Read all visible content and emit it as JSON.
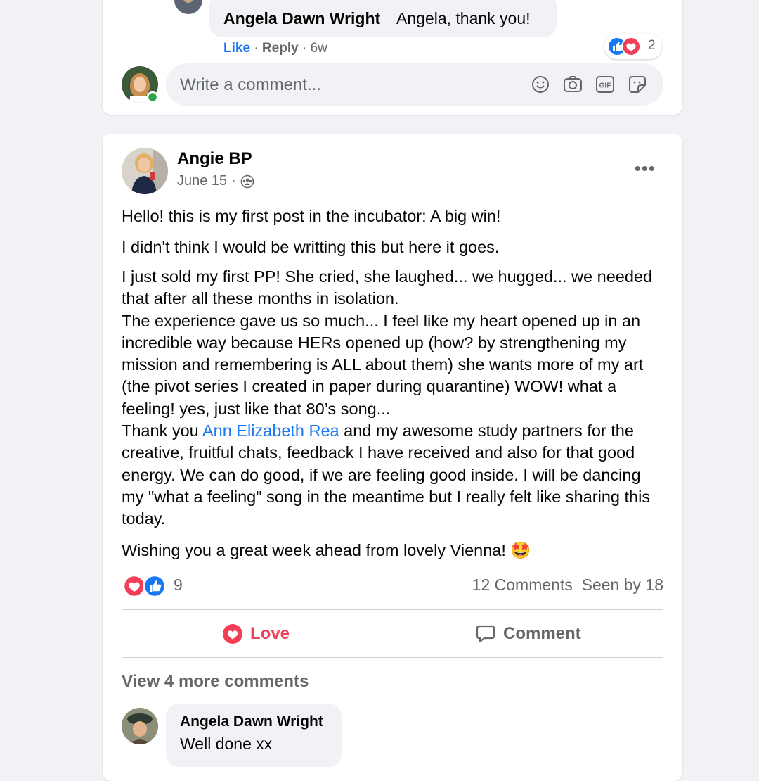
{
  "top_comment": {
    "author": "Angela Dawn Wright",
    "text": "Angela, thank you!",
    "reaction_count": "2",
    "like_label": "Like",
    "reply_label": "Reply",
    "age": "6w"
  },
  "composer": {
    "placeholder": "Write a comment..."
  },
  "post": {
    "author": "Angie BP",
    "date": "June 15",
    "paragraphs": {
      "p1": "Hello! this is my first post in the incubator: A big win!",
      "p2": "I didn't think I would be writting this but here it goes.",
      "p3a": "I just sold my first PP! She cried, she laughed... we hugged... we needed that after all these months in isolation.",
      "p3b": "The experience gave us so much... I feel like my heart opened up in an incredible way because HERs opened up (how? by strengthening my mission and remembering is ALL about them) she wants more of my art (the pivot series I created in paper during quarantine) WOW! what a feeling! yes, just like that 80’s song...",
      "p3c_before": "Thank you ",
      "p3c_mention": "Ann Elizabeth Rea",
      "p3c_after": " and my awesome study partners for the creative, fruitful chats, feedback I have received and also for that good energy. We can do good, if we are feeling good inside. I will be dancing my \"what a feeling\" song in the meantime but I really felt like sharing this today.",
      "p4": "Wishing you a great week ahead from lovely Vienna! 🤩"
    },
    "reaction_count": "9",
    "comments_count": "12 Comments",
    "seen_by": "Seen by 18",
    "love_label": "Love",
    "comment_label": "Comment",
    "view_more": "View 4 more comments"
  },
  "bottom_comment": {
    "author": "Angela Dawn Wright",
    "text": "Well done xx"
  },
  "colors": {
    "brand_blue": "#1877f2",
    "love_red": "#f33e58",
    "muted": "#65676b",
    "background": "#f0f2f5"
  },
  "icons": [
    "emoji-icon",
    "camera-icon",
    "gif-icon",
    "sticker-icon",
    "like-reaction-icon",
    "love-reaction-icon",
    "members-icon",
    "more-icon",
    "comment-icon"
  ]
}
